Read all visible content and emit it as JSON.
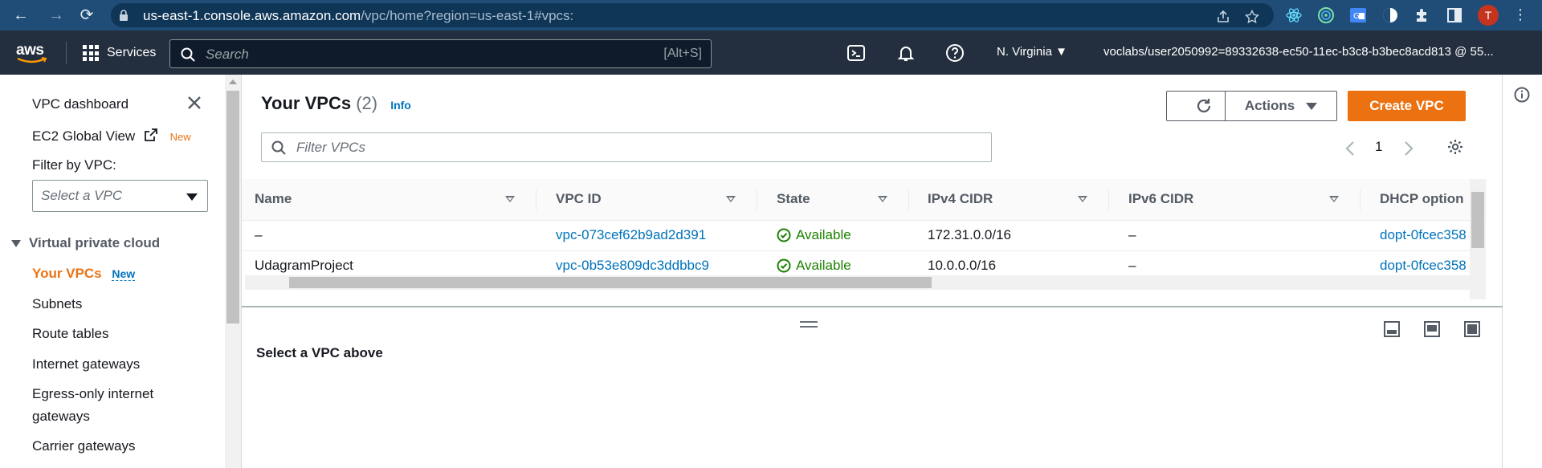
{
  "browser": {
    "url_host": "us-east-1.console.aws.amazon.com",
    "url_path": "/vpc/home?region=us-east-1#vpcs:",
    "avatar_initial": "T"
  },
  "aws_bar": {
    "logo_text": "aws",
    "services_label": "Services",
    "search_placeholder": "Search",
    "search_shortcut": "[Alt+S]",
    "region_label": "N. Virginia ▼",
    "account_label": "voclabs/user2050992=89332638-ec50-11ec-b3c8-b3bec8acd813 @ 55..."
  },
  "sidebar": {
    "dashboard_label": "VPC dashboard",
    "ec2_label": "EC2 Global View",
    "ec2_badge": "New",
    "filter_label": "Filter by VPC:",
    "filter_placeholder": "Select a VPC",
    "section_title": "Virtual private cloud",
    "active_item": "Your VPCs",
    "active_badge": "New",
    "items": [
      "Subnets",
      "Route tables",
      "Internet gateways",
      "Egress-only internet",
      "gateways",
      "Carrier gateways"
    ]
  },
  "main": {
    "title": "Your VPCs",
    "count": "(2)",
    "info_label": "Info",
    "actions_label": "Actions",
    "create_label": "Create VPC",
    "filter_placeholder": "Filter VPCs",
    "page_number": "1",
    "columns": [
      "Name",
      "VPC ID",
      "State",
      "IPv4 CIDR",
      "IPv6 CIDR",
      "DHCP option"
    ],
    "rows": [
      {
        "name": "–",
        "vpc_id": "vpc-073cef62b9ad2d391",
        "state": "Available",
        "ipv4": "172.31.0.0/16",
        "ipv6": "–",
        "dhcp": "dopt-0fcec358"
      },
      {
        "name": "UdagramProject",
        "vpc_id": "vpc-0b53e809dc3ddbbc9",
        "state": "Available",
        "ipv4": "10.0.0.0/16",
        "ipv6": "–",
        "dhcp": "dopt-0fcec358"
      }
    ],
    "detail_placeholder": "Select a VPC above"
  },
  "colors": {
    "chrome_bg": "#1f4d78",
    "aws_bar_bg": "#232f3e",
    "accent_orange": "#ec7211",
    "link_blue": "#0073bb",
    "success_green": "#1d8102"
  }
}
